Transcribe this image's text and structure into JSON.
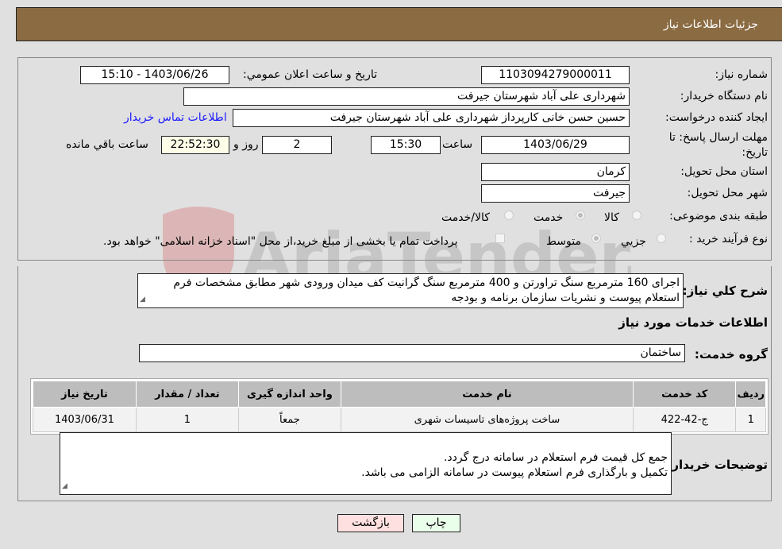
{
  "header": {
    "title": "جزئیات اطلاعات نیاز"
  },
  "form": {
    "need_number": {
      "label": "شماره نیاز:",
      "value": "1103094279000011"
    },
    "announce_datetime": {
      "label": "تاریخ و ساعت اعلان عمومي:",
      "value": "1403/06/26 - 15:10"
    },
    "buyer_org": {
      "label": "نام دستگاه خریدار:",
      "value": "شهرداری علی آباد شهرستان جیرفت"
    },
    "requester": {
      "label": "ایجاد کننده درخواست:",
      "value": "حسین حسن خانی کارپرداز شهرداری علی آباد شهرستان جیرفت"
    },
    "buyer_contact_link": "اطلاعات تماس خریدار",
    "deadline": {
      "label": "مهلت ارسال پاسخ: تا تاریخ:",
      "date": "1403/06/29",
      "time_label": "ساعت",
      "time": "15:30",
      "days": "2",
      "days_label": "روز و",
      "remaining": "22:52:30",
      "remaining_label": "ساعت باقي مانده"
    },
    "province": {
      "label": "استان محل تحویل:",
      "value": "کرمان"
    },
    "city": {
      "label": "شهر محل تحویل:",
      "value": "جیرفت"
    },
    "category": {
      "label": "طبقه بندی موضوعی:",
      "options": [
        "کالا",
        "خدمت",
        "کالا/خدمت"
      ],
      "selected": "خدمت"
    },
    "purchase_process": {
      "label": "نوع فرآیند خرید :",
      "options": [
        "جزيي",
        "متوسط"
      ],
      "selected": "متوسط",
      "treasury_checkbox_label": "پرداخت تمام یا بخشی از مبلغ خرید،از محل \"اسناد خزانه اسلامی\" خواهد بود.",
      "treasury_checked": false
    }
  },
  "description": {
    "label": "شرح کلي نیاز:",
    "value": "اجرای 160 مترمربع سنگ تراورتن و 400 مترمربع سنگ گرانیت کف میدان ورودی شهر مطابق مشخصات فرم استعلام پیوست و نشریات سازمان برنامه و بودجه"
  },
  "services": {
    "section_title": "اطلاعات خدمات مورد نیاز",
    "group_label": "گروه خدمت:",
    "group_value": "ساختمان",
    "table": {
      "headers": [
        "ردیف",
        "کد خدمت",
        "نام خدمت",
        "واحد اندازه گیری",
        "تعداد / مقدار",
        "تاریخ نیاز"
      ],
      "rows": [
        [
          "1",
          "ج-42-422",
          "ساخت پروژه‌های تاسیسات شهری",
          "جمعاً",
          "1",
          "1403/06/31"
        ]
      ]
    }
  },
  "buyer_notes": {
    "label": "توضیحات خریدار:",
    "value": "جمع کل قیمت فرم استعلام در سامانه درج گردد.\nتکمیل و بارگذاری فرم استعلام پیوست در سامانه الزامی می باشد."
  },
  "buttons": {
    "print": "چاپ",
    "back": "بازگشت"
  },
  "watermark_text": "AriaTender.neT",
  "colors": {
    "header_bg": "#8b6b42",
    "print_bg": "#eaffea",
    "back_bg": "#ffe0e0",
    "link": "#1a1aff"
  }
}
